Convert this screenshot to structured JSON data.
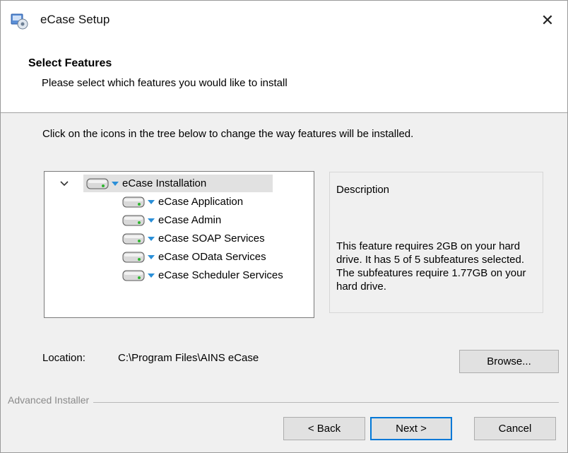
{
  "window": {
    "title": "eCase Setup",
    "close_label": "✕"
  },
  "banner": {
    "title": "Select Features",
    "subtitle": "Please select which features you would like to install"
  },
  "instruction": "Click on the icons in the tree below to change the way features will be installed.",
  "tree": {
    "root": {
      "label": "eCase Installation",
      "expanded": true
    },
    "children": [
      {
        "label": "eCase Application"
      },
      {
        "label": "eCase Admin"
      },
      {
        "label": "eCase SOAP Services"
      },
      {
        "label": "eCase OData Services"
      },
      {
        "label": "eCase Scheduler Services"
      }
    ]
  },
  "description": {
    "title": "Description",
    "text": "This feature requires 2GB on your hard drive. It has 5 of 5 subfeatures selected. The subfeatures require 1.77GB on your hard drive."
  },
  "location": {
    "label": "Location:",
    "value": "C:\\Program Files\\AINS eCase"
  },
  "buttons": {
    "browse": "Browse...",
    "back": "< Back",
    "next": "Next >",
    "cancel": "Cancel"
  },
  "footer": {
    "brand": "Advanced Installer"
  },
  "colors": {
    "accent": "#0078d7",
    "selection": "#e1e1e1",
    "dropdown_arrow": "#2a8fd8",
    "drive_led": "#2fb52f"
  },
  "icons": {
    "title": "setup-installer-icon",
    "close": "close-icon",
    "expand": "chevron-down-icon",
    "feature": "hard-drive-icon",
    "feature_menu": "dropdown-arrow-icon"
  }
}
